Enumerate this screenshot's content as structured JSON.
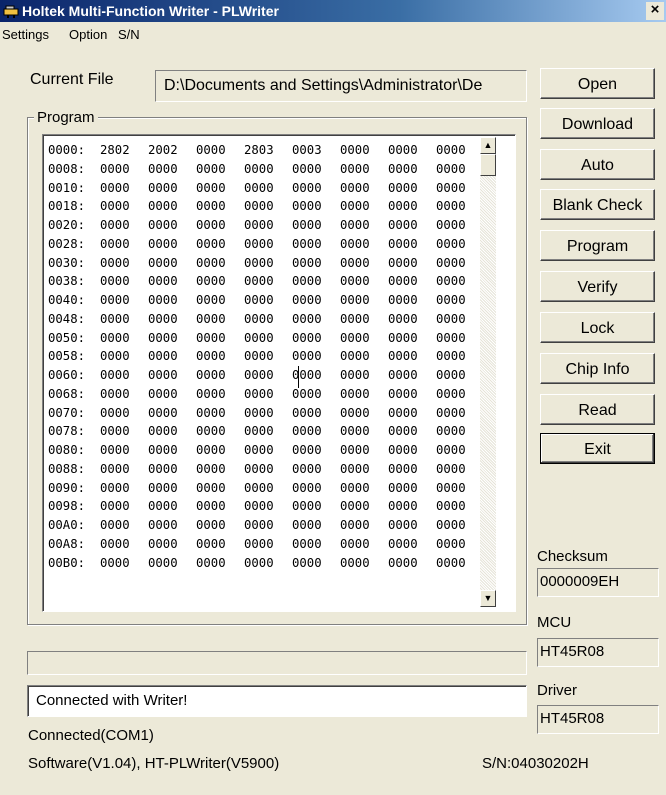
{
  "window": {
    "title": "Holtek Multi-Function Writer - PLWriter",
    "close_glyph": "×"
  },
  "menu": [
    "Settings",
    "Option",
    "S/N"
  ],
  "current_file": {
    "label": "Current File",
    "value": "D:\\Documents and Settings\\Administrator\\De"
  },
  "program": {
    "label": "Program",
    "rows": [
      {
        "addr": "0000:",
        "words": [
          "2802",
          "2002",
          "0000",
          "2803",
          "0003",
          "0000",
          "0000",
          "0000"
        ]
      },
      {
        "addr": "0008:",
        "words": [
          "0000",
          "0000",
          "0000",
          "0000",
          "0000",
          "0000",
          "0000",
          "0000"
        ]
      },
      {
        "addr": "0010:",
        "words": [
          "0000",
          "0000",
          "0000",
          "0000",
          "0000",
          "0000",
          "0000",
          "0000"
        ]
      },
      {
        "addr": "0018:",
        "words": [
          "0000",
          "0000",
          "0000",
          "0000",
          "0000",
          "0000",
          "0000",
          "0000"
        ]
      },
      {
        "addr": "0020:",
        "words": [
          "0000",
          "0000",
          "0000",
          "0000",
          "0000",
          "0000",
          "0000",
          "0000"
        ]
      },
      {
        "addr": "0028:",
        "words": [
          "0000",
          "0000",
          "0000",
          "0000",
          "0000",
          "0000",
          "0000",
          "0000"
        ]
      },
      {
        "addr": "0030:",
        "words": [
          "0000",
          "0000",
          "0000",
          "0000",
          "0000",
          "0000",
          "0000",
          "0000"
        ]
      },
      {
        "addr": "0038:",
        "words": [
          "0000",
          "0000",
          "0000",
          "0000",
          "0000",
          "0000",
          "0000",
          "0000"
        ]
      },
      {
        "addr": "0040:",
        "words": [
          "0000",
          "0000",
          "0000",
          "0000",
          "0000",
          "0000",
          "0000",
          "0000"
        ]
      },
      {
        "addr": "0048:",
        "words": [
          "0000",
          "0000",
          "0000",
          "0000",
          "0000",
          "0000",
          "0000",
          "0000"
        ]
      },
      {
        "addr": "0050:",
        "words": [
          "0000",
          "0000",
          "0000",
          "0000",
          "0000",
          "0000",
          "0000",
          "0000"
        ]
      },
      {
        "addr": "0058:",
        "words": [
          "0000",
          "0000",
          "0000",
          "0000",
          "0000",
          "0000",
          "0000",
          "0000"
        ]
      },
      {
        "addr": "0060:",
        "words": [
          "0000",
          "0000",
          "0000",
          "0000",
          "0000",
          "0000",
          "0000",
          "0000"
        ]
      },
      {
        "addr": "0068:",
        "words": [
          "0000",
          "0000",
          "0000",
          "0000",
          "0000",
          "0000",
          "0000",
          "0000"
        ]
      },
      {
        "addr": "0070:",
        "words": [
          "0000",
          "0000",
          "0000",
          "0000",
          "0000",
          "0000",
          "0000",
          "0000"
        ]
      },
      {
        "addr": "0078:",
        "words": [
          "0000",
          "0000",
          "0000",
          "0000",
          "0000",
          "0000",
          "0000",
          "0000"
        ]
      },
      {
        "addr": "0080:",
        "words": [
          "0000",
          "0000",
          "0000",
          "0000",
          "0000",
          "0000",
          "0000",
          "0000"
        ]
      },
      {
        "addr": "0088:",
        "words": [
          "0000",
          "0000",
          "0000",
          "0000",
          "0000",
          "0000",
          "0000",
          "0000"
        ]
      },
      {
        "addr": "0090:",
        "words": [
          "0000",
          "0000",
          "0000",
          "0000",
          "0000",
          "0000",
          "0000",
          "0000"
        ]
      },
      {
        "addr": "0098:",
        "words": [
          "0000",
          "0000",
          "0000",
          "0000",
          "0000",
          "0000",
          "0000",
          "0000"
        ]
      },
      {
        "addr": "00A0:",
        "words": [
          "0000",
          "0000",
          "0000",
          "0000",
          "0000",
          "0000",
          "0000",
          "0000"
        ]
      },
      {
        "addr": "00A8:",
        "words": [
          "0000",
          "0000",
          "0000",
          "0000",
          "0000",
          "0000",
          "0000",
          "0000"
        ]
      },
      {
        "addr": "00B0:",
        "words": [
          "0000",
          "0000",
          "0000",
          "0000",
          "0000",
          "0000",
          "0000",
          "0000"
        ]
      }
    ]
  },
  "buttons": {
    "open": "Open",
    "download": "Download",
    "auto": "Auto",
    "blank_check": "Blank Check",
    "program": "Program",
    "verify": "Verify",
    "lock": "Lock",
    "chip_info": "Chip Info",
    "read": "Read",
    "exit": "Exit"
  },
  "checksum": {
    "label": "Checksum",
    "value": "0000009EH"
  },
  "mcu": {
    "label": "MCU",
    "value": "HT45R08"
  },
  "driver": {
    "label": "Driver",
    "value": "HT45R08"
  },
  "progress": {
    "fraction": 0
  },
  "message": "Connected with Writer!",
  "status": {
    "connection": "Connected(COM1)",
    "software": "Software(V1.04),  HT-PLWriter(V5900)",
    "serial": "S/N:04030202H"
  },
  "icons": {
    "app": "writer-app-icon",
    "scroll_up": "scroll-up-arrow-icon",
    "scroll_down": "scroll-down-arrow-icon"
  },
  "colors": {
    "titlebar": "#0a246a",
    "face": "#ece9d8"
  }
}
